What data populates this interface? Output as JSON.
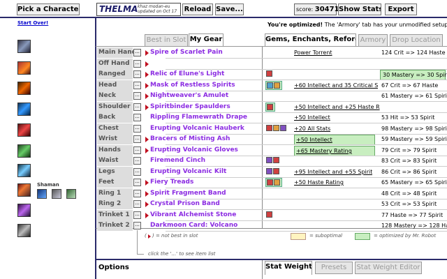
{
  "topbar": {
    "pick_character": "Pick a Character",
    "character_name": "THELMA",
    "realm_line1": "khaz modan-eu",
    "realm_line2": "updated on Oct 17",
    "reload": "Reload",
    "save": "Save...",
    "score_label": "score:",
    "score_value": "30471",
    "show_stats": "Show Stats",
    "export": "Export"
  },
  "left": {
    "start_over": "Start Over!",
    "class_label": "Shaman",
    "spell_icons": [
      "spell-icon-1",
      "spell-icon-2",
      "spell-icon-3",
      "spell-icon-4",
      "spell-icon-5",
      "spell-icon-6",
      "spell-icon-7",
      "spell-icon-8",
      "spell-icon-9",
      "spell-icon-10"
    ]
  },
  "tabs_left": {
    "best_in_slot": "Best in Slot",
    "my_gear": "My Gear"
  },
  "tabs_right": {
    "gems": "Gems, Enchants, Reforges",
    "armory": "Armory",
    "drop_location": "Drop Location"
  },
  "optimized_msg": {
    "bold": "You're optimized!",
    "rest": " The 'Armory' tab has your unmodified setup."
  },
  "gear": [
    {
      "slot": "Main Hand",
      "item": "Spire of Scarlet Pain",
      "nbis": true,
      "gems": [],
      "enchant": "Power Torrent",
      "enchant_hl": false,
      "reforge": "124 Crit => 124 Haste",
      "reforge_hl": false
    },
    {
      "slot": "Off Hand",
      "item": "",
      "nbis": true,
      "gems": [],
      "enchant": "",
      "enchant_hl": false,
      "reforge": "",
      "reforge_hl": false
    },
    {
      "slot": "Ranged",
      "item": "Relic of Elune's Light",
      "nbis": true,
      "gems": [
        "#d04040"
      ],
      "gem_hl": false,
      "enchant": "",
      "enchant_hl": false,
      "reforge": "30 Mastery => 30 Spirit",
      "reforge_hl": true
    },
    {
      "slot": "Head",
      "item": "Mask of Restless Spirits",
      "nbis": true,
      "gems": [
        "#50a0d0",
        "#e0a040"
      ],
      "gem_hl": true,
      "enchant": "+60 Intellect and 35 Critical S",
      "enchant_hl": false,
      "reforge": "67 Crit => 67 Haste",
      "reforge_hl": false
    },
    {
      "slot": "Neck",
      "item": "Nightweaver's Amulet",
      "nbis": true,
      "gems": [],
      "enchant": "",
      "enchant_hl": false,
      "reforge": "61 Mastery => 61 Spirit",
      "reforge_hl": false
    },
    {
      "slot": "Shoulder",
      "item": "Spiritbinder Spaulders",
      "nbis": true,
      "gems": [
        "#d04040"
      ],
      "gem_hl": true,
      "enchant": "+50 Intellect and +25 Haste R",
      "enchant_hl": false,
      "reforge": "",
      "reforge_hl": false
    },
    {
      "slot": "Back",
      "item": "Rippling Flamewrath Drape",
      "nbis": false,
      "gems": [],
      "enchant": "+50 Intellect",
      "enchant_hl": false,
      "reforge": "53 Hit => 53 Spirit",
      "reforge_hl": false
    },
    {
      "slot": "Chest",
      "item": "Erupting Volcanic Hauberk",
      "nbis": false,
      "gems": [
        "#d04040",
        "#e0a040",
        "#8050c0"
      ],
      "gem_hl": false,
      "enchant": "+20 All Stats",
      "enchant_hl": false,
      "reforge": "98 Mastery => 98 Spirit",
      "reforge_hl": false
    },
    {
      "slot": "Wrist",
      "item": "Bracers of Misting Ash",
      "nbis": true,
      "gems": [],
      "enchant": "+50 Intellect",
      "enchant_hl": true,
      "reforge": "59 Mastery => 59 Spirit",
      "reforge_hl": false
    },
    {
      "slot": "Hands",
      "item": "Erupting Volcanic Gloves",
      "nbis": true,
      "gems": [],
      "enchant": "+65 Mastery Rating",
      "enchant_hl": true,
      "reforge": "79 Crit => 79 Spirit",
      "reforge_hl": false
    },
    {
      "slot": "Waist",
      "item": "Firemend Cinch",
      "nbis": false,
      "gems": [
        "#8050c0",
        "#d04040"
      ],
      "gem_hl": false,
      "enchant": "",
      "enchant_hl": false,
      "reforge": "83 Crit => 83 Spirit",
      "reforge_hl": false
    },
    {
      "slot": "Legs",
      "item": "Erupting Volcanic Kilt",
      "nbis": false,
      "gems": [
        "#8050c0",
        "#d04040"
      ],
      "gem_hl": false,
      "enchant": "+95 Intellect and +55 Spirit",
      "enchant_hl": false,
      "reforge": "86 Crit => 86 Spirit",
      "reforge_hl": false
    },
    {
      "slot": "Feet",
      "item": "Fiery Treads",
      "nbis": true,
      "gems": [
        "#d04040",
        "#e0a040"
      ],
      "gem_hl": true,
      "enchant": "+50 Haste Rating",
      "enchant_hl": false,
      "reforge": "65 Mastery => 65 Spirit",
      "reforge_hl": false
    },
    {
      "slot": "Ring 1",
      "item": "Spirit Fragment Band",
      "nbis": true,
      "gems": [],
      "enchant": "",
      "enchant_hl": false,
      "reforge": "48 Crit => 48 Spirit",
      "reforge_hl": false
    },
    {
      "slot": "Ring 2",
      "item": "Crystal Prison Band",
      "nbis": true,
      "gems": [],
      "enchant": "",
      "enchant_hl": false,
      "reforge": "53 Crit => 53 Spirit",
      "reforge_hl": false
    },
    {
      "slot": "Trinket 1",
      "item": "Vibrant Alchemist Stone",
      "nbis": true,
      "gems": [
        "#d04040"
      ],
      "gem_hl": false,
      "enchant": "",
      "enchant_hl": false,
      "reforge": "77 Haste => 77 Spirit",
      "reforge_hl": false
    },
    {
      "slot": "Trinket 2",
      "item": "Darkmoon Card: Volcano",
      "nbis": false,
      "gems": [],
      "enchant": "",
      "enchant_hl": false,
      "reforge": "128 Mastery => 128 Has",
      "reforge_hl": false
    }
  ],
  "legend": {
    "nbis_prefix": "(",
    "nbis_suffix": ") = not best in slot",
    "click_hint": "click the '...' to see item list",
    "suboptimal": "= suboptimal",
    "optimized": "= optimized by Mr. Robot"
  },
  "bottom": {
    "options": "Options",
    "stat_weights": "Stat Weights",
    "presets": "Presets",
    "stat_weight_editor": "Stat Weight Editor"
  },
  "colors": {
    "frame": "#2a2a6a",
    "item_purple": "#8b2be2",
    "nbis_red": "#c01020",
    "optimized_green": "#c8eec0",
    "suboptimal_yellow": "#fff4c0"
  }
}
